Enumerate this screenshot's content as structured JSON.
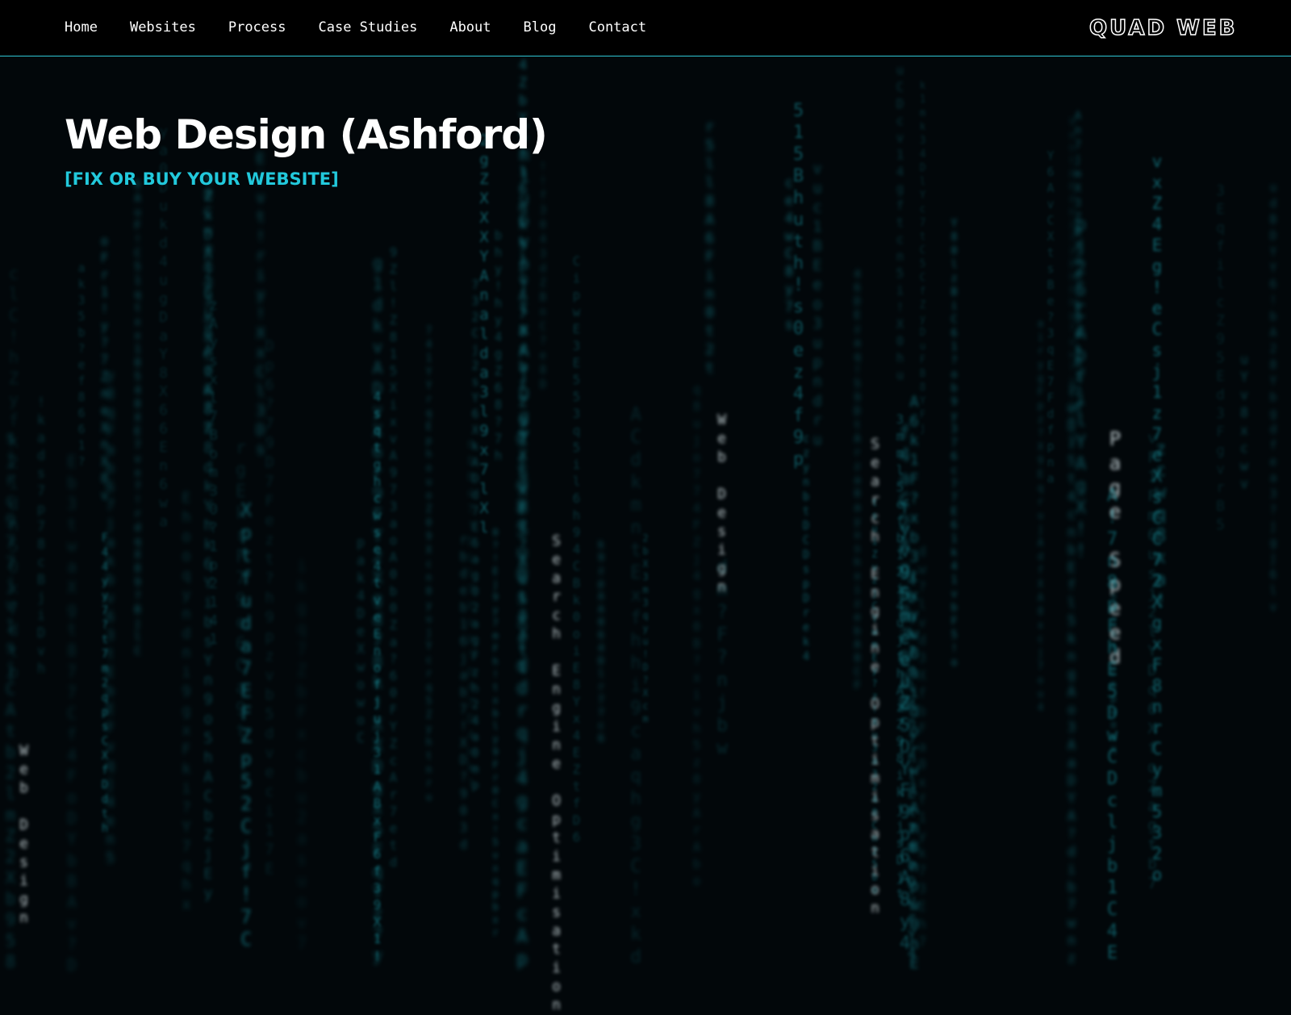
{
  "nav": {
    "items": [
      "Home",
      "Websites",
      "Process",
      "Case Studies",
      "About",
      "Blog",
      "Contact"
    ]
  },
  "logo": {
    "text": "QUAD WEB",
    "accent": "#2fc6d4"
  },
  "hero": {
    "title": "Web Design (Ashford)",
    "subtitle": "[FIX OR BUY YOUR WEBSITE]"
  },
  "background": {
    "rain_words": [
      "Page Speed",
      "Search Engine Optimisation",
      "Web Design",
      "Search Engine Optimisation",
      "Web Design"
    ],
    "colors": {
      "bright": "#d8e6ea",
      "dim": "#1aa6b4"
    }
  }
}
